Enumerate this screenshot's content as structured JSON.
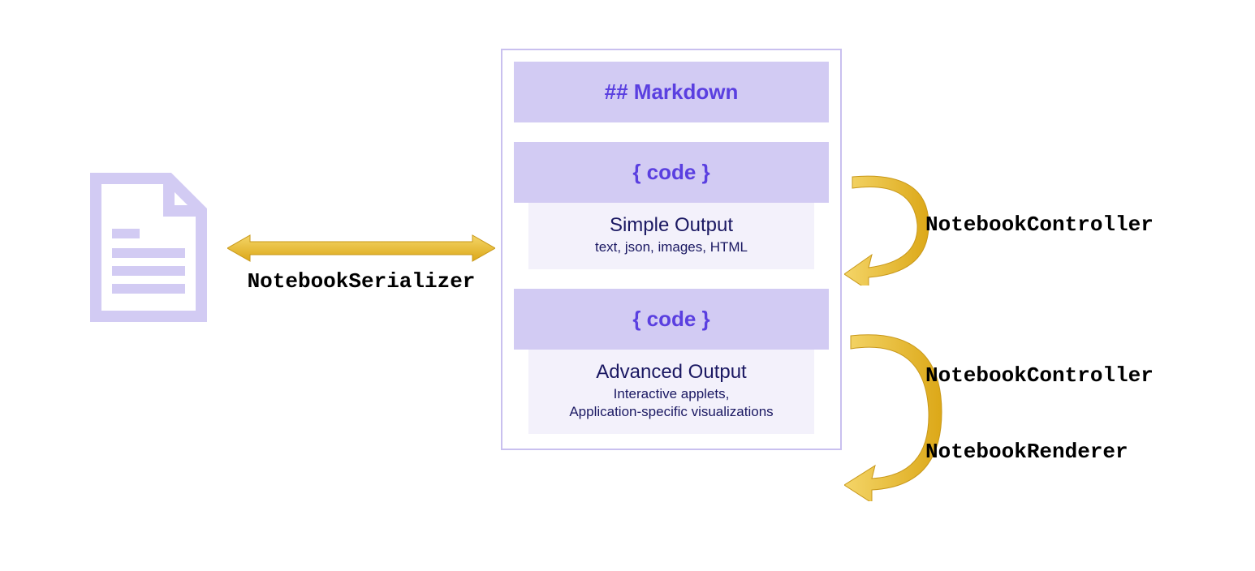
{
  "labels": {
    "serializer": "NotebookSerializer",
    "controller1": "NotebookController",
    "controller2": "NotebookController",
    "renderer": "NotebookRenderer"
  },
  "notebook": {
    "markdown_cell": "## Markdown",
    "code_cell_1": "{ code }",
    "simple_output": {
      "title": "Simple Output",
      "subtitle": "text, json, images, HTML"
    },
    "code_cell_2": "{ code }",
    "advanced_output": {
      "title": "Advanced Output",
      "subtitle_line1": "Interactive applets,",
      "subtitle_line2": "Application-specific visualizations"
    }
  },
  "colors": {
    "lavender_fill": "#d2cbf3",
    "lavender_light": "#f3f1fb",
    "lavender_stroke": "#c9c0ef",
    "purple_text": "#5a3fe0",
    "dark_navy": "#1a1862",
    "gold": "#e6b422",
    "gold_light": "#f0c94a"
  }
}
